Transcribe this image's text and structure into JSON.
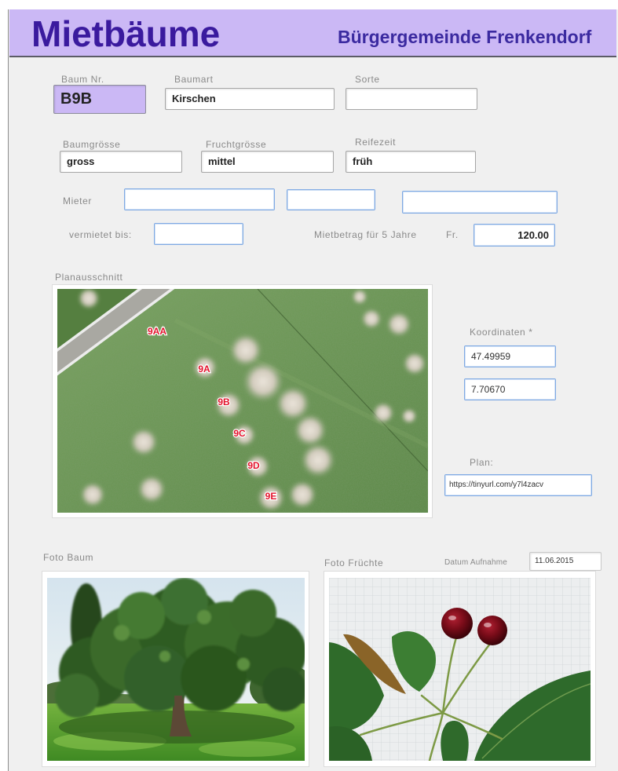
{
  "header": {
    "title": "Mietbäume",
    "subtitle": "Bürgergemeinde Frenkendorf"
  },
  "tree": {
    "nr": {
      "label": "Baum Nr.",
      "value": "B9B"
    },
    "art": {
      "label": "Baumart",
      "value": "Kirschen"
    },
    "sorte": {
      "label": "Sorte",
      "value": ""
    },
    "groesse": {
      "label": "Baumgrösse",
      "value": "gross"
    },
    "fruchtgroesse": {
      "label": "Fruchtgrösse",
      "value": "mittel"
    },
    "reifezeit": {
      "label": "Reifezeit",
      "value": "früh"
    }
  },
  "rental": {
    "mieter_label": "Mieter",
    "mieter": [
      "",
      "",
      ""
    ],
    "vermietet_bis_label": "vermietet bis:",
    "vermietet_bis": "",
    "betrag_label": "Mietbetrag für 5 Jahre",
    "currency": "Fr.",
    "betrag": "120.00"
  },
  "plan": {
    "label": "Planausschnitt",
    "tree_labels": [
      "9AA",
      "9A",
      "9B",
      "9C",
      "9D",
      "9E"
    ],
    "koordinaten_label": "Koordinaten *",
    "lat": "47.49959",
    "lon": "7.70670",
    "plan_label": "Plan:",
    "plan_url": "https://tinyurl.com/y7l4zacv"
  },
  "photos": {
    "baum_label": "Foto Baum",
    "fruechte_label": "Foto Früchte",
    "datum_label": "Datum Aufnahme",
    "datum": "11.06.2015"
  },
  "colors": {
    "header_bg": "#cbb8f5",
    "title": "#3a1a9e",
    "field_border_active": "#7ea9e3",
    "map_label": "#e3132c"
  }
}
